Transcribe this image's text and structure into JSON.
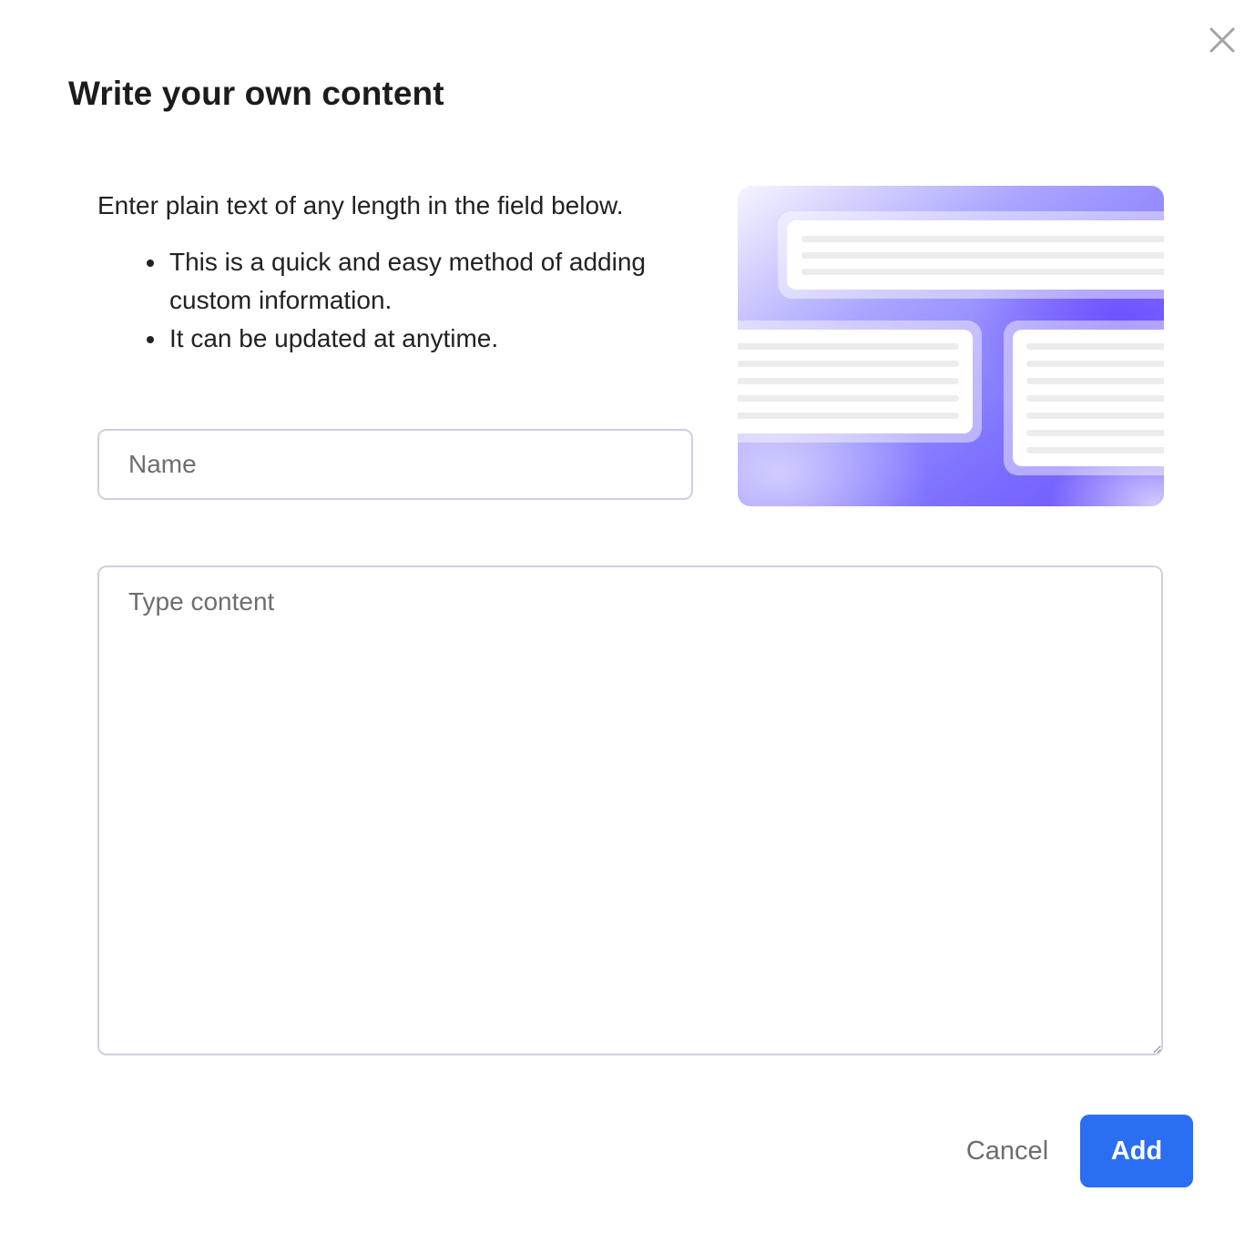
{
  "dialog": {
    "title": "Write your own content",
    "close_icon": "close-icon"
  },
  "intro": {
    "lead": "Enter plain text of any length in the field below.",
    "bullets": [
      "This is a quick and easy method of adding custom information.",
      "It can be updated at anytime."
    ]
  },
  "form": {
    "name_placeholder": "Name",
    "name_value": "",
    "content_placeholder": "Type content",
    "content_value": ""
  },
  "illustration": {
    "icon": "content-cards-illustration",
    "gradient_colors": [
      "#f4f3ff",
      "#8b86ff",
      "#6a55ff"
    ]
  },
  "actions": {
    "cancel_label": "Cancel",
    "add_label": "Add"
  },
  "colors": {
    "primary": "#2a6ef2",
    "input_border": "#cfcfe0"
  }
}
